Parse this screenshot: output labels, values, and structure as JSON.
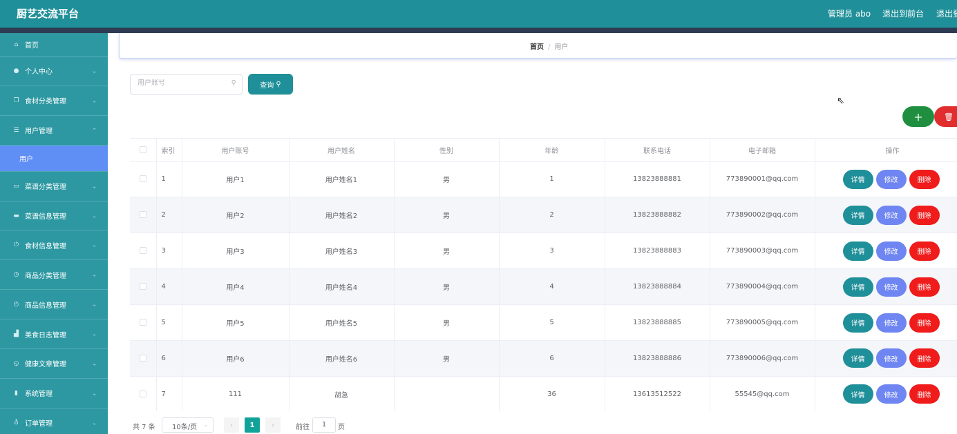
{
  "header": {
    "title": "厨艺交流平台",
    "admin": "管理员 abo",
    "to_front": "退出到前台",
    "logout": "退出登"
  },
  "sidebar": {
    "items": [
      {
        "label": "首页",
        "icon": "home-icon"
      },
      {
        "label": "个人中心",
        "icon": "user-icon"
      },
      {
        "label": "食材分类管理",
        "icon": "copy-icon"
      },
      {
        "label": "用户管理",
        "icon": "list-icon"
      },
      {
        "label": "菜谱分类管理",
        "icon": "chat-icon"
      },
      {
        "label": "菜谱信息管理",
        "icon": "monitor-icon"
      },
      {
        "label": "食材信息管理",
        "icon": "power-icon"
      },
      {
        "label": "商品分类管理",
        "icon": "clock-icon"
      },
      {
        "label": "商品信息管理",
        "icon": "compass-icon"
      },
      {
        "label": "美食日志管理",
        "icon": "thumb-icon"
      },
      {
        "label": "健康文章管理",
        "icon": "compass-icon"
      },
      {
        "label": "系统管理",
        "icon": "chart-icon"
      },
      {
        "label": "订单管理",
        "icon": "mic-icon"
      }
    ],
    "sub_item": "用户"
  },
  "breadcrumb": {
    "home": "首页",
    "separator": "/",
    "current": "用户"
  },
  "search": {
    "placeholder": "用户账号",
    "button": "查询"
  },
  "table": {
    "headers": [
      "索引",
      "用户账号",
      "用户姓名",
      "性别",
      "年龄",
      "联系电话",
      "电子邮箱",
      "操作"
    ],
    "rows": [
      {
        "index": "1",
        "account": "用户1",
        "name": "用户姓名1",
        "gender": "男",
        "age": "1",
        "phone": "13823888881",
        "email": "773890001@qq.com"
      },
      {
        "index": "2",
        "account": "用户2",
        "name": "用户姓名2",
        "gender": "男",
        "age": "2",
        "phone": "13823888882",
        "email": "773890002@qq.com"
      },
      {
        "index": "3",
        "account": "用户3",
        "name": "用户姓名3",
        "gender": "男",
        "age": "3",
        "phone": "13823888883",
        "email": "773890003@qq.com"
      },
      {
        "index": "4",
        "account": "用户4",
        "name": "用户姓名4",
        "gender": "男",
        "age": "4",
        "phone": "13823888884",
        "email": "773890004@qq.com"
      },
      {
        "index": "5",
        "account": "用户5",
        "name": "用户姓名5",
        "gender": "男",
        "age": "5",
        "phone": "13823888885",
        "email": "773890005@qq.com"
      },
      {
        "index": "6",
        "account": "用户6",
        "name": "用户姓名6",
        "gender": "男",
        "age": "6",
        "phone": "13823888886",
        "email": "773890006@qq.com"
      },
      {
        "index": "7",
        "account": "111",
        "name": "胡急",
        "gender": "",
        "age": "36",
        "phone": "13613512522",
        "email": "55545@qq.com"
      }
    ],
    "actions": {
      "detail": "详情",
      "edit": "修改",
      "delete": "删除"
    }
  },
  "pagination": {
    "total": "共 7 条",
    "page_size": "10条/页",
    "current_page": "1",
    "goto_label": "前往",
    "goto_value": "1",
    "page_word": "页"
  },
  "colors": {
    "primary": "#1f8f99",
    "add": "#1f8f3f",
    "danger": "#e02d2d",
    "edit": "#6f86f2",
    "active_menu": "#5f8ef5"
  }
}
